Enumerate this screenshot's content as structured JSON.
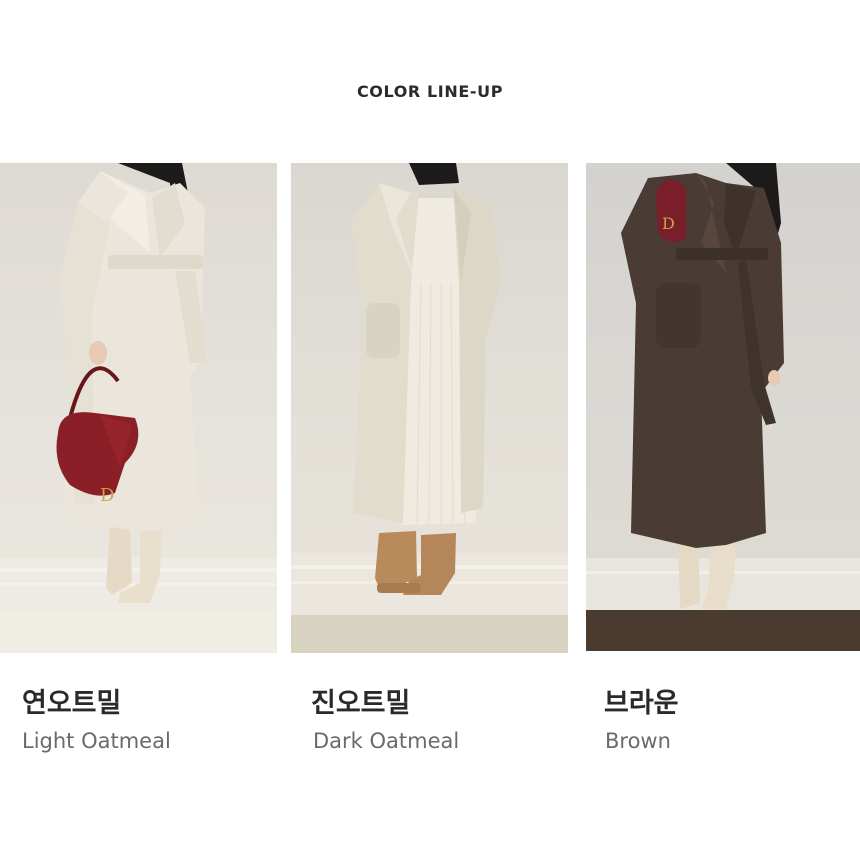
{
  "header": {
    "title": "COLOR LINE-UP"
  },
  "colors": [
    {
      "name_ko": "연오트밀",
      "name_en": "Light Oatmeal",
      "swatch": "#f0ede5",
      "coat_color": "#ece7dd",
      "bag_color": "#8a1f27",
      "boots_color": "#e8ddca"
    },
    {
      "name_ko": "진오트밀",
      "name_en": "Dark Oatmeal",
      "swatch": "#d8d3c0",
      "coat_color": "#e2dccd",
      "dress_color": "#f0ebe0",
      "boots_color": "#b98a5c"
    },
    {
      "name_ko": "브라운",
      "name_en": "Brown",
      "swatch": "#4b3b2f",
      "coat_color": "#4a3b34",
      "bag_color": "#7a1f2a",
      "boots_color": "#e5d9c6"
    }
  ]
}
